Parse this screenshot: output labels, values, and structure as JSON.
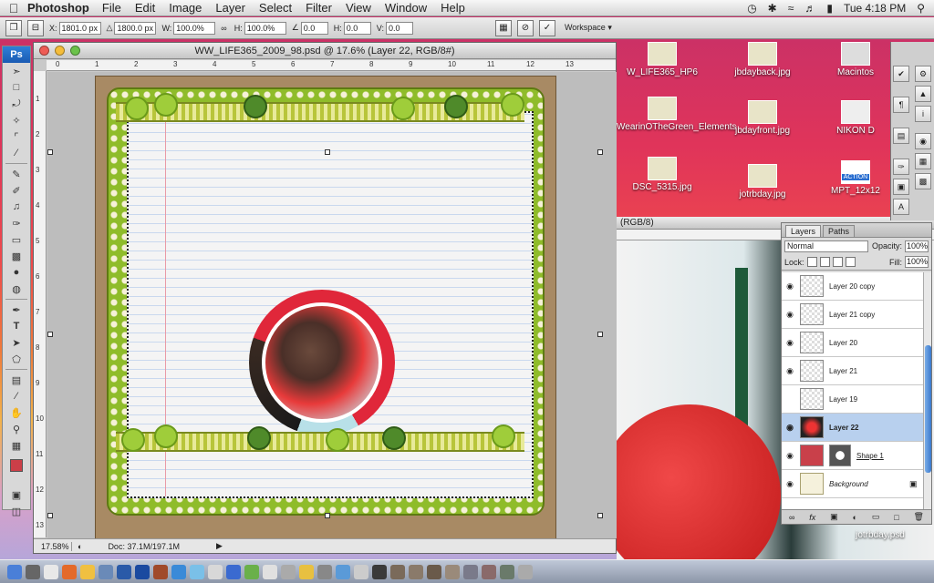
{
  "menubar": {
    "app_name": "Photoshop",
    "menus": [
      "File",
      "Edit",
      "Image",
      "Layer",
      "Select",
      "Filter",
      "View",
      "Window",
      "Help"
    ],
    "clock": "Tue 4:18 PM"
  },
  "options_bar": {
    "x_label": "X:",
    "x_value": "1801.0 px",
    "y_value": "1800.0 px",
    "w_label": "W:",
    "w_value": "100.0%",
    "h_label": "H:",
    "h_value": "100.0%",
    "angle_value": "0.0",
    "hskew_label": "H:",
    "hskew_value": "0.0",
    "vskew_label": "V:",
    "vskew_value": "0.0",
    "workspace_label": "Workspace"
  },
  "tools": {
    "badge": "Ps"
  },
  "document": {
    "title": "WW_LIFE365_2009_98.psd @ 17.6% (Layer 22, RGB/8#)",
    "ruler_top": [
      "0",
      "1",
      "2",
      "3",
      "4",
      "5",
      "6",
      "7",
      "8",
      "9",
      "10",
      "11",
      "12",
      "13"
    ],
    "ruler_left": [
      "1",
      "2",
      "3",
      "4",
      "5",
      "6",
      "7",
      "8",
      "9",
      "10",
      "11",
      "12",
      "13"
    ],
    "zoom": "17.58%",
    "doc_size": "Doc: 37.1M/197.1M"
  },
  "desktop_icons": [
    {
      "label": "W_LIFE365_HP6"
    },
    {
      "label": "jbdayback.jpg"
    },
    {
      "label": "Macintos"
    },
    {
      "label": "WearinOTheGreen_Elements"
    },
    {
      "label": "jbdayfront.jpg"
    },
    {
      "label": "NIKON D"
    },
    {
      "label": "DSC_5315.jpg"
    },
    {
      "label": "jotrbday.jpg"
    },
    {
      "label": "MPT_12x12"
    },
    {
      "label": "jotrbday.psd"
    }
  ],
  "action_badge": "ACTION",
  "photo_window": {
    "title": "(RGB/8)"
  },
  "layers_panel": {
    "tabs": [
      "Layers",
      "Paths"
    ],
    "blend_mode": "Normal",
    "opacity_label": "Opacity:",
    "opacity_value": "100%",
    "lock_label": "Lock:",
    "fill_label": "Fill:",
    "fill_value": "100%",
    "layers": [
      {
        "name": "Layer 20 copy",
        "visible": true,
        "selected": false
      },
      {
        "name": "Layer 21 copy",
        "visible": true,
        "selected": false
      },
      {
        "name": "Layer 20",
        "visible": true,
        "selected": false
      },
      {
        "name": "Layer 21",
        "visible": true,
        "selected": false
      },
      {
        "name": "Layer 19",
        "visible": false,
        "selected": false
      },
      {
        "name": "Layer 22",
        "visible": true,
        "selected": true
      },
      {
        "name": "Shape 1",
        "visible": true,
        "selected": false
      },
      {
        "name": "Background",
        "visible": true,
        "selected": false
      }
    ]
  }
}
